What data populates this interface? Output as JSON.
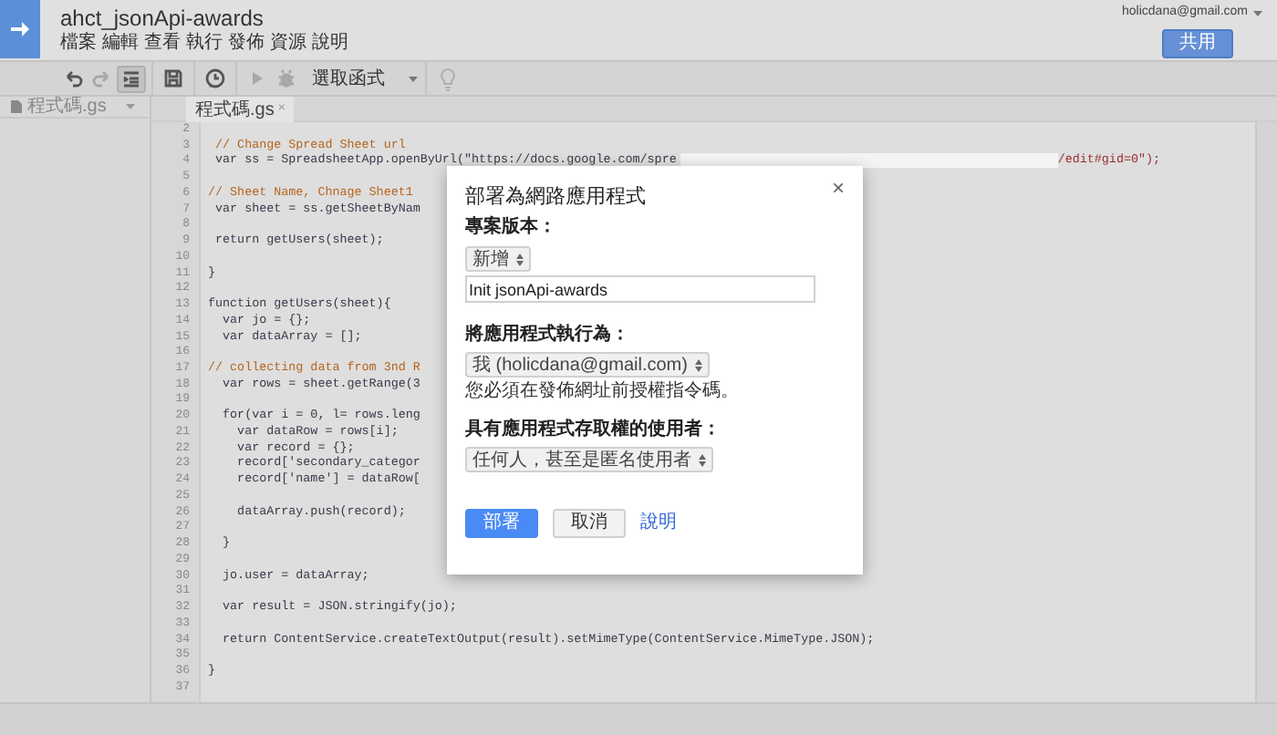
{
  "app": {
    "title": "ahct_jsonApi-awards",
    "menu": [
      "檔案",
      "編輯",
      "查看",
      "執行",
      "發佈",
      "資源",
      "說明"
    ],
    "account": "holicdana@gmail.com",
    "share_button": "共用"
  },
  "toolbar": {
    "tools": [
      {
        "kind": "undo",
        "disabled": false,
        "pressed": false
      },
      {
        "kind": "redo",
        "disabled": true,
        "pressed": false
      },
      {
        "kind": "indent",
        "disabled": false,
        "pressed": true
      },
      {
        "kind": "save",
        "disabled": false,
        "pressed": false
      },
      {
        "kind": "trigger",
        "disabled": false,
        "pressed": false
      },
      {
        "kind": "run",
        "disabled": true,
        "pressed": false
      },
      {
        "kind": "debug",
        "disabled": true,
        "pressed": false
      }
    ],
    "function_select": "選取函式",
    "hint_disabled": true
  },
  "sidebar": {
    "files": [
      "程式碼.gs"
    ]
  },
  "editor": {
    "tabs": [
      {
        "label": "程式碼.gs",
        "close": "×",
        "selected": true
      }
    ],
    "lines": [
      {
        "number": "2"
      },
      {
        "number": "3",
        "text": " // Change Spread Sheet url",
        "kind": "comment"
      },
      {
        "number": "4",
        "text": " var ss = SpreadsheetApp.openByUrl(\"https://docs.google.com/spre",
        "tail": "/edit#gid=0\");",
        "kind": "code"
      },
      {
        "number": "5"
      },
      {
        "number": "6",
        "text": "// Sheet Name, Chnage Sheet1",
        "kind": "comment"
      },
      {
        "number": "7",
        "text": " var sheet = ss.getSheetByNam",
        "kind": "code"
      },
      {
        "number": "8"
      },
      {
        "number": "9",
        "text": " return getUsers(sheet);",
        "kind": "code"
      },
      {
        "number": "10"
      },
      {
        "number": "11",
        "text": "}",
        "kind": "code"
      },
      {
        "number": "12"
      },
      {
        "number": "13",
        "text": "function getUsers(sheet){",
        "kind": "code"
      },
      {
        "number": "14",
        "text": "  var jo = {};",
        "kind": "code"
      },
      {
        "number": "15",
        "text": "  var dataArray = [];",
        "kind": "code"
      },
      {
        "number": "16"
      },
      {
        "number": "17",
        "text": "// collecting data from 3nd R",
        "kind": "comment"
      },
      {
        "number": "18",
        "text": "  var rows = sheet.getRange(3",
        "kind": "code"
      },
      {
        "number": "19"
      },
      {
        "number": "20",
        "text": "  for(var i = 0, l= rows.leng",
        "kind": "code"
      },
      {
        "number": "21",
        "text": "    var dataRow = rows[i];",
        "kind": "code"
      },
      {
        "number": "22",
        "text": "    var record = {};",
        "kind": "code"
      },
      {
        "number": "23",
        "text": "    record['secondary_categor",
        "kind": "code"
      },
      {
        "number": "24",
        "text": "    record['name'] = dataRow[",
        "kind": "code"
      },
      {
        "number": "25"
      },
      {
        "number": "26",
        "text": "    dataArray.push(record);",
        "kind": "code"
      },
      {
        "number": "27"
      },
      {
        "number": "28",
        "text": "  }",
        "kind": "code"
      },
      {
        "number": "29"
      },
      {
        "number": "30",
        "text": "  jo.user = dataArray;",
        "kind": "code"
      },
      {
        "number": "31"
      },
      {
        "number": "32",
        "text": "  var result = JSON.stringify(jo);",
        "kind": "code"
      },
      {
        "number": "33"
      },
      {
        "number": "34",
        "text": "  return ContentService.createTextOutput(result).setMimeType(ContentService.MimeType.JSON);",
        "kind": "code"
      },
      {
        "number": "35"
      },
      {
        "number": "36",
        "text": "}",
        "kind": "code"
      },
      {
        "number": "37"
      }
    ]
  },
  "dialog": {
    "title": "部署為網路應用程式",
    "close": "×",
    "version_label": "專案版本：",
    "version_select": "新增",
    "version_note": "Init jsonApi-awards",
    "execute_label": "將應用程式執行為：",
    "execute_select": "我 (holicdana@gmail.com)",
    "authorize_note": "您必須在發佈網址前授權指令碼。",
    "access_label": "具有應用程式存取權的使用者：",
    "access_select": "任何人，甚至是匿名使用者",
    "deploy_button": "部署",
    "cancel_button": "取消",
    "help_link": "說明"
  }
}
